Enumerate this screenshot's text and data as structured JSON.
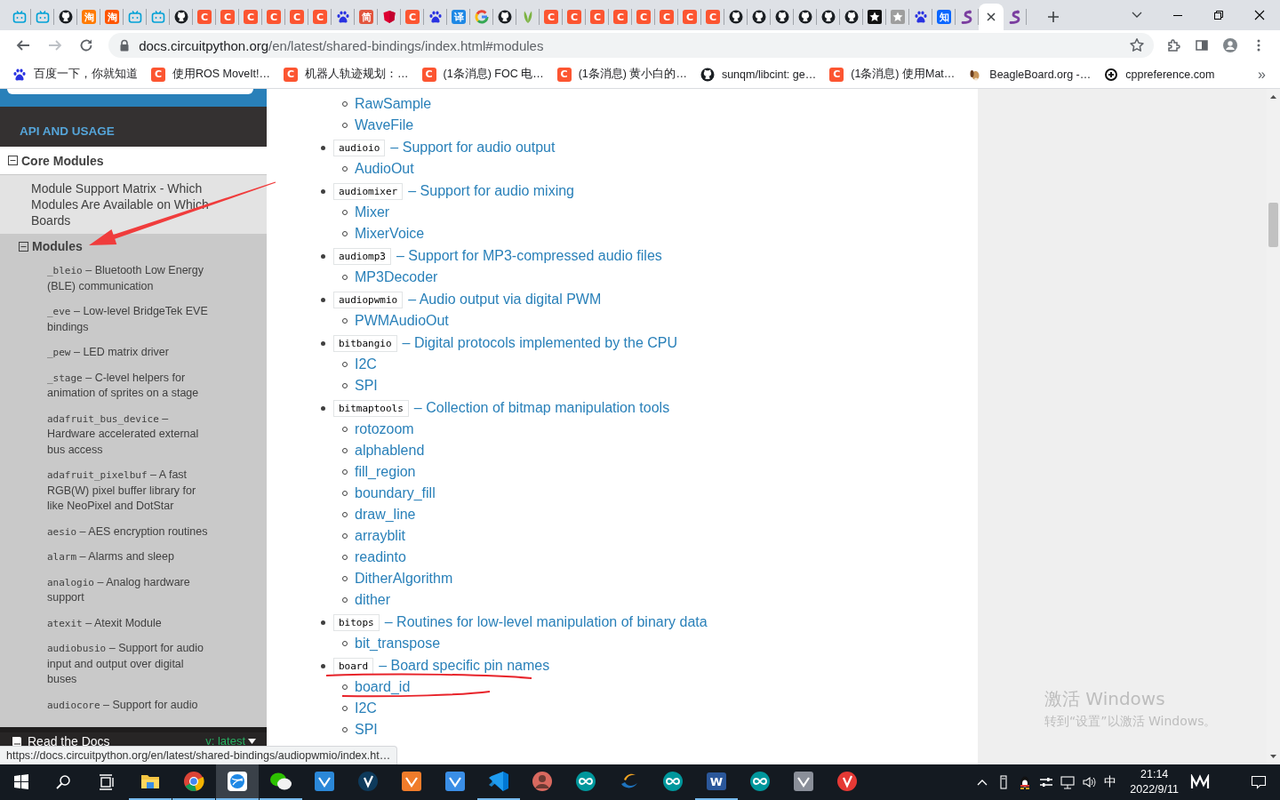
{
  "browser": {
    "tabs": [
      {
        "kind": "tv",
        "selected": false
      },
      {
        "kind": "tv",
        "selected": false
      },
      {
        "kind": "github",
        "selected": false
      },
      {
        "kind": "letter",
        "letter": "淘",
        "color": "#ff7a00",
        "selected": false
      },
      {
        "kind": "letter",
        "letter": "淘",
        "color": "#ff5500",
        "selected": false
      },
      {
        "kind": "tv",
        "selected": false
      },
      {
        "kind": "tv",
        "selected": false
      },
      {
        "kind": "github",
        "selected": false
      },
      {
        "kind": "letter",
        "letter": "C",
        "color": "#fc5531",
        "selected": false
      },
      {
        "kind": "letter",
        "letter": "C",
        "color": "#fc5531",
        "selected": false
      },
      {
        "kind": "letter",
        "letter": "C",
        "color": "#fc5531",
        "selected": false
      },
      {
        "kind": "letter",
        "letter": "C",
        "color": "#fc5531",
        "selected": false
      },
      {
        "kind": "letter",
        "letter": "C",
        "color": "#fc5531",
        "selected": false
      },
      {
        "kind": "letter",
        "letter": "C",
        "color": "#fc5531",
        "selected": false
      },
      {
        "kind": "paw",
        "selected": false
      },
      {
        "kind": "letter",
        "letter": "简",
        "color": "#e2553d",
        "selected": false
      },
      {
        "kind": "shield",
        "selected": false
      },
      {
        "kind": "letter",
        "letter": "C",
        "color": "#fc5531",
        "selected": false
      },
      {
        "kind": "paw",
        "selected": false
      },
      {
        "kind": "letter",
        "letter": "译",
        "color": "#1e88e5",
        "selected": false
      },
      {
        "kind": "ring",
        "selected": false
      },
      {
        "kind": "github",
        "selected": false
      },
      {
        "kind": "leaf",
        "selected": false
      },
      {
        "kind": "letter",
        "letter": "C",
        "color": "#fc5531",
        "selected": false
      },
      {
        "kind": "letter",
        "letter": "C",
        "color": "#fc5531",
        "selected": false
      },
      {
        "kind": "letter",
        "letter": "C",
        "color": "#fc5531",
        "selected": false
      },
      {
        "kind": "letter",
        "letter": "C",
        "color": "#fc5531",
        "selected": false
      },
      {
        "kind": "letter",
        "letter": "C",
        "color": "#fc5531",
        "selected": false
      },
      {
        "kind": "letter",
        "letter": "C",
        "color": "#fc5531",
        "selected": false
      },
      {
        "kind": "letter",
        "letter": "C",
        "color": "#fc5531",
        "selected": false
      },
      {
        "kind": "letter",
        "letter": "C",
        "color": "#fc5531",
        "selected": false
      },
      {
        "kind": "github",
        "selected": false
      },
      {
        "kind": "github",
        "selected": false
      },
      {
        "kind": "github",
        "selected": false
      },
      {
        "kind": "github",
        "selected": false
      },
      {
        "kind": "github",
        "selected": false
      },
      {
        "kind": "github",
        "selected": false
      },
      {
        "kind": "star",
        "color": "#111111",
        "selected": false
      },
      {
        "kind": "star",
        "color": "#9e9e9e",
        "selected": false
      },
      {
        "kind": "paw",
        "selected": false
      },
      {
        "kind": "letter",
        "letter": "知",
        "color": "#0a66ff",
        "selected": false
      },
      {
        "kind": "snake",
        "selected": false
      },
      {
        "kind": "blank",
        "selected": true
      },
      {
        "kind": "snake",
        "selected": false
      }
    ]
  },
  "toolbar": {
    "address": {
      "host": "docs.circuitpython.org",
      "path": "/en/latest/shared-bindings/index.html#modules"
    }
  },
  "bookmarks": {
    "items": [
      {
        "icon": {
          "kind": "paw"
        },
        "label": "百度一下，你就知道"
      },
      {
        "icon": {
          "kind": "letter",
          "letter": "C",
          "color": "#fc5531"
        },
        "label": "使用ROS MoveIt!…"
      },
      {
        "icon": {
          "kind": "letter",
          "letter": "C",
          "color": "#fc5531"
        },
        "label": "机器人轨迹规划：…"
      },
      {
        "icon": {
          "kind": "letter",
          "letter": "C",
          "color": "#fc5531"
        },
        "label": "(1条消息) FOC 电…"
      },
      {
        "icon": {
          "kind": "letter",
          "letter": "C",
          "color": "#fc5531"
        },
        "label": "(1条消息) 黄小白的…"
      },
      {
        "icon": {
          "kind": "github"
        },
        "label": "sunqm/libcint: ge…"
      },
      {
        "icon": {
          "kind": "letter",
          "letter": "C",
          "color": "#fc5531"
        },
        "label": "(1条消息) 使用Mat…"
      },
      {
        "icon": {
          "kind": "dog"
        },
        "label": "BeagleBoard.org -…"
      },
      {
        "icon": {
          "kind": "plus"
        },
        "label": "cppreference.com"
      }
    ],
    "more": "»"
  },
  "sidebar": {
    "caption": "API AND USAGE",
    "tree": [
      {
        "label": "Core Modules",
        "expanded": true,
        "children": [
          {
            "label": "Module Support Matrix - Which Modules Are Available on Which Boards"
          },
          {
            "label": "Modules",
            "expanded": true,
            "children": [
              {
                "code": "_bleio",
                "text": "– Bluetooth Low Energy (BLE) communication"
              },
              {
                "code": "_eve",
                "text": "– Low-level BridgeTek EVE bindings"
              },
              {
                "code": "_pew",
                "text": "– LED matrix driver"
              },
              {
                "code": "_stage",
                "text": "– C-level helpers for animation of sprites on a stage"
              },
              {
                "code": "adafruit_bus_device",
                "text": "– Hardware accelerated external bus access"
              },
              {
                "code": "adafruit_pixelbuf",
                "text": "– A fast RGB(W) pixel buffer library for like NeoPixel and DotStar"
              },
              {
                "code": "aesio",
                "text": "– AES encryption routines"
              },
              {
                "code": "alarm",
                "text": "– Alarms and sleep"
              },
              {
                "code": "analogio",
                "text": "– Analog hardware support"
              },
              {
                "code": "atexit",
                "text": "– Atexit Module"
              },
              {
                "code": "audiobusio",
                "text": "– Support for audio input and output over digital buses"
              },
              {
                "code": "audiocore",
                "text": "– Support for audio"
              }
            ]
          }
        ]
      }
    ],
    "footer": {
      "brand": "Read the Docs",
      "version": "v: latest"
    }
  },
  "main": {
    "modules": [
      {
        "children": [
          "RawSample",
          "WaveFile"
        ]
      },
      {
        "code": "audioio",
        "text": "– Support for audio output",
        "children": [
          "AudioOut"
        ]
      },
      {
        "code": "audiomixer",
        "text": "– Support for audio mixing",
        "children": [
          "Mixer",
          "MixerVoice"
        ]
      },
      {
        "code": "audiomp3",
        "text": "– Support for MP3-compressed audio files",
        "children": [
          "MP3Decoder"
        ]
      },
      {
        "code": "audiopwmio",
        "text": "– Audio output via digital PWM",
        "children": [
          "PWMAudioOut"
        ]
      },
      {
        "code": "bitbangio",
        "text": "– Digital protocols implemented by the CPU",
        "children": [
          "I2C",
          "SPI"
        ]
      },
      {
        "code": "bitmaptools",
        "text": "– Collection of bitmap manipulation tools",
        "children": [
          "rotozoom",
          "alphablend",
          "fill_region",
          "boundary_fill",
          "draw_line",
          "arrayblit",
          "readinto",
          "DitherAlgorithm",
          "dither"
        ]
      },
      {
        "code": "bitops",
        "text": "– Routines for low-level manipulation of binary data",
        "children": [
          "bit_transpose"
        ]
      },
      {
        "code": "board",
        "text": "– Board specific pin names",
        "children": [
          "board_id",
          "I2C",
          "SPI"
        ]
      }
    ]
  },
  "activation": {
    "title": "激活 Windows",
    "hint": "转到“设置”以激活 Windows。"
  },
  "status_url": "https://docs.circuitpython.org/en/latest/shared-bindings/audiopwmio/index.ht…",
  "taskbar": {
    "apps": [
      {
        "kind": "folder",
        "running": true,
        "selected": false
      },
      {
        "kind": "chrome",
        "running": true,
        "selected": false
      },
      {
        "kind": "globe",
        "running": true,
        "selected": true
      },
      {
        "kind": "chat",
        "running": true,
        "selected": false
      },
      {
        "kind": "tile",
        "color": "#2b88d8",
        "running": false,
        "selected": false
      },
      {
        "kind": "circle",
        "color": "#0e3a5b",
        "running": false,
        "selected": false
      },
      {
        "kind": "tile",
        "color": "#f07c2b",
        "running": false,
        "selected": false
      },
      {
        "kind": "tile",
        "color": "#3a8ee6",
        "running": false,
        "selected": false
      },
      {
        "kind": "ribbon",
        "running": true,
        "selected": false
      },
      {
        "kind": "avatar",
        "running": false,
        "selected": false
      },
      {
        "kind": "infinity",
        "running": false,
        "selected": false
      },
      {
        "kind": "swirl",
        "running": false,
        "selected": false
      },
      {
        "kind": "infinity",
        "running": false,
        "selected": false
      },
      {
        "kind": "letter",
        "letter": "W",
        "color": "#2b579a",
        "running": true,
        "selected": false
      },
      {
        "kind": "infinity",
        "running": false,
        "selected": false
      },
      {
        "kind": "tile",
        "color": "#8a8f99",
        "running": false,
        "selected": false
      },
      {
        "kind": "circle",
        "color": "#e53935",
        "running": false,
        "selected": false
      }
    ],
    "tray": {
      "ime": "中",
      "time": "21:14",
      "date": "2022/9/11"
    }
  }
}
